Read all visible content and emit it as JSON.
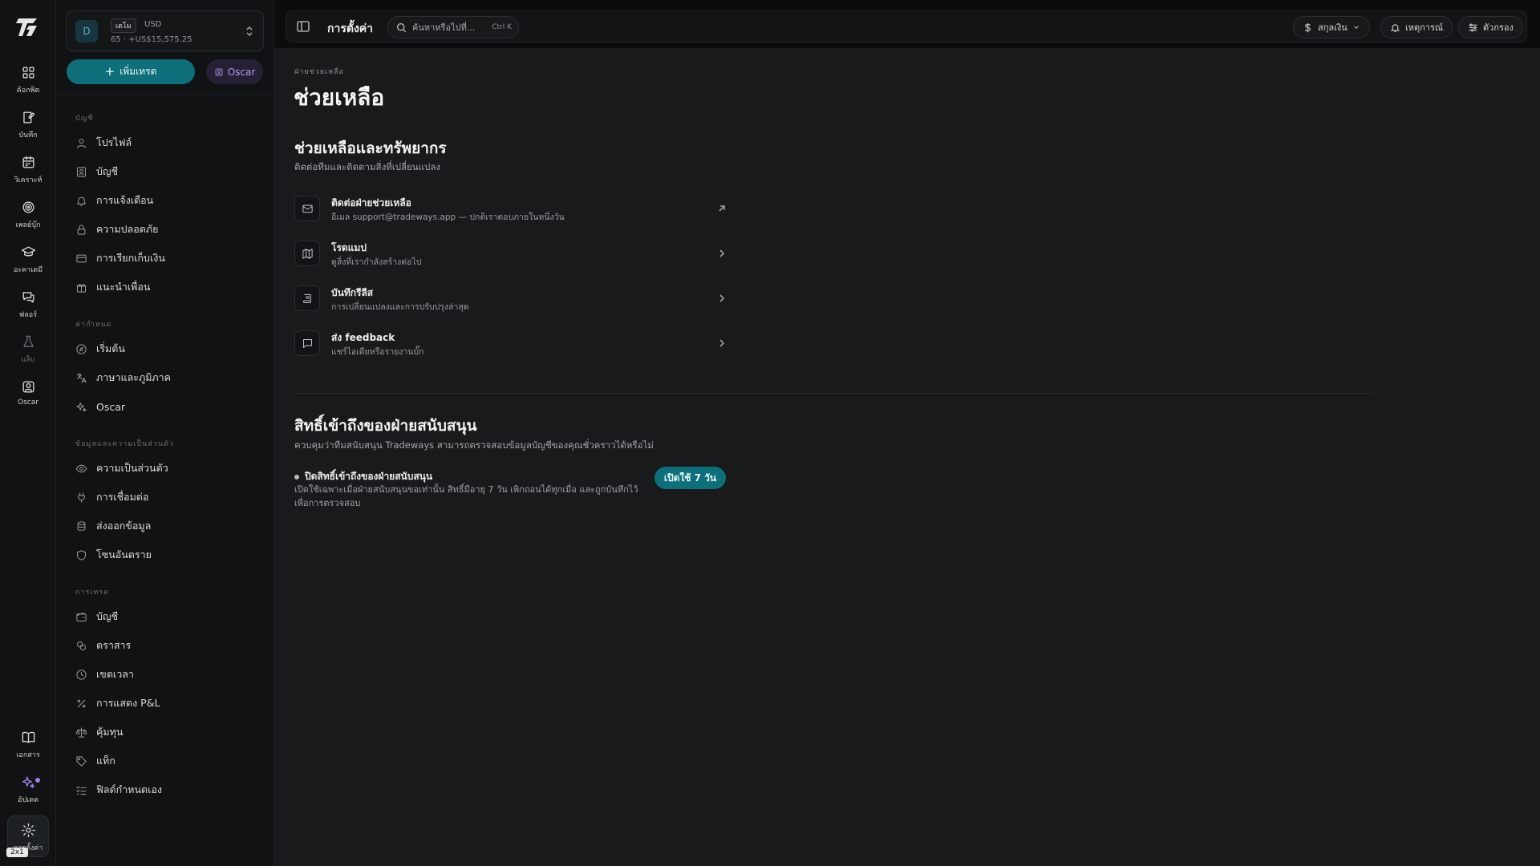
{
  "rail": {
    "items": [
      {
        "label": "ค้อกพิต",
        "icon": "grid-icon"
      },
      {
        "label": "บันทึก",
        "icon": "journal-icon"
      },
      {
        "label": "วิเคราะห์",
        "icon": "calendar-icon"
      },
      {
        "label": "เพลย์บุ๊ก",
        "icon": "target-icon"
      },
      {
        "label": "อะคาเดมี",
        "icon": "graduation-cap-icon"
      },
      {
        "label": "ฟลอร์",
        "icon": "chat-icon"
      },
      {
        "label": "แล็บ",
        "icon": "flask-icon"
      },
      {
        "label": "Oscar",
        "icon": "oscar-icon"
      }
    ],
    "bottom": {
      "docs": "เอกสาร",
      "updates": "อัปเดต",
      "settings": "การตั้งค่า",
      "badge": "2x1"
    }
  },
  "account": {
    "avatar": "D",
    "badge": "เดโม",
    "currency": "USD",
    "summary": "65 · +US$15,575.25"
  },
  "sidebar": {
    "add_trade": "เพิ่มเทรด",
    "oscar": "Oscar",
    "sections": [
      {
        "heading": "บัญชี",
        "items": [
          {
            "label": "โปรไฟล์",
            "icon": "user-icon"
          },
          {
            "label": "บัญชี",
            "icon": "account-icon"
          },
          {
            "label": "การแจ้งเตือน",
            "icon": "bell-icon"
          },
          {
            "label": "ความปลอดภัย",
            "icon": "lock-icon"
          },
          {
            "label": "การเรียกเก็บเงิน",
            "icon": "credit-card-icon"
          },
          {
            "label": "แนะนำเพื่อน",
            "icon": "gift-icon"
          }
        ]
      },
      {
        "heading": "ค่ากำหนด",
        "items": [
          {
            "label": "เริ่มต้น",
            "icon": "compass-icon"
          },
          {
            "label": "ภาษาและภูมิภาค",
            "icon": "translate-icon"
          },
          {
            "label": "Oscar",
            "icon": "sparkles-icon"
          }
        ]
      },
      {
        "heading": "ข้อมูลและความเป็นส่วนตัว",
        "items": [
          {
            "label": "ความเป็นส่วนตัว",
            "icon": "eye-icon"
          },
          {
            "label": "การเชื่อมต่อ",
            "icon": "plug-icon"
          },
          {
            "label": "ส่งออกข้อมูล",
            "icon": "database-icon"
          },
          {
            "label": "โซนอันตราย",
            "icon": "shield-icon"
          }
        ]
      },
      {
        "heading": "การเทรด",
        "items": [
          {
            "label": "บัญชี",
            "icon": "wallet-icon"
          },
          {
            "label": "ตราสาร",
            "icon": "coins-icon"
          },
          {
            "label": "เขตเวลา",
            "icon": "clock-icon"
          },
          {
            "label": "การแสดง P&L",
            "icon": "percent-icon"
          },
          {
            "label": "คุ้มทุน",
            "icon": "scale-icon"
          },
          {
            "label": "แท็ก",
            "icon": "tag-icon"
          },
          {
            "label": "ฟิลด์กำหนดเอง",
            "icon": "list-checks-icon"
          }
        ]
      }
    ]
  },
  "topbar": {
    "title": "การตั้งค่า",
    "search_placeholder": "ค้นหาหรือไปที่...",
    "search_shortcut": "Ctrl K",
    "currency": "สกุลเงิน",
    "events": "เหตุการณ์",
    "filter": "ตัวกรอง"
  },
  "main": {
    "breadcrumb": "ฝ่ายช่วยเหลือ",
    "title": "ช่วยเหลือ",
    "resources": {
      "title": "ช่วยเหลือและทรัพยากร",
      "subtitle": "ติดต่อทีมและติดตามสิ่งที่เปลี่ยนแปลง",
      "items": [
        {
          "title": "ติดต่อฝ่ายช่วยเหลือ",
          "desc": "อีเมล support@tradeways.app — ปกติเราตอบภายในหนึ่งวัน",
          "icon": "mail-icon",
          "arrow": "external-arrow-icon"
        },
        {
          "title": "โรดแมป",
          "desc": "ดูสิ่งที่เรากำลังสร้างต่อไป",
          "icon": "map-icon",
          "arrow": "chevron-right-icon"
        },
        {
          "title": "บันทึกรีลีส",
          "desc": "การเปลี่ยนแปลงและการปรับปรุงล่าสุด",
          "icon": "scroll-icon",
          "arrow": "chevron-right-icon"
        },
        {
          "title": "ส่ง feedback",
          "desc": "แชร์ไอเดียหรือรายงานบั๊ก",
          "icon": "message-icon",
          "arrow": "chevron-right-icon"
        }
      ]
    },
    "access": {
      "title": "สิทธิ์เข้าถึงของฝ่ายสนับสนุน",
      "subtitle": "ควบคุมว่าทีมสนับสนุน Tradeways สามารถตรวจสอบข้อมูลบัญชีของคุณชั่วคราวได้หรือไม่",
      "status_title": "ปิดสิทธิ์เข้าถึงของฝ่ายสนับสนุน",
      "status_desc": "เปิดใช้เฉพาะเมื่อฝ่ายสนับสนุนขอเท่านั้น สิทธิ์มีอายุ 7 วัน เพิกถอนได้ทุกเมื่อ และถูกบันทึกไว้เพื่อการตรวจสอบ",
      "button": "เปิดใช้ 7 วัน"
    }
  },
  "colors": {
    "accent": "#0e6f7b",
    "oscar": "#b79af5",
    "background": "#181a1c"
  }
}
